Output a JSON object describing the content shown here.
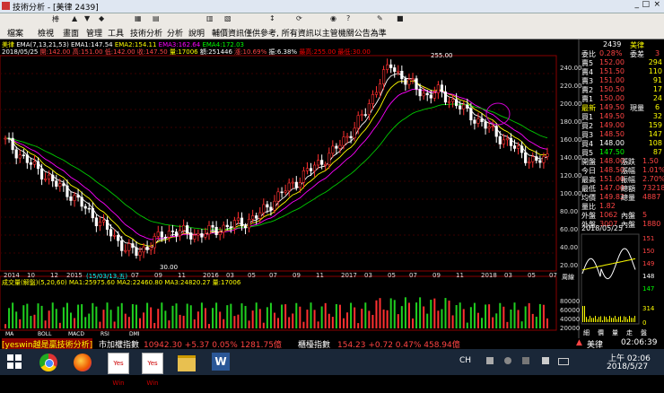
{
  "window": {
    "title": "技術分析 - [美律 2439]",
    "min": "_",
    "max": "□",
    "close": "×"
  },
  "toolbar": {
    "chart_btn": "棒",
    "items": [
      "▲",
      "▼",
      "◆",
      "▦",
      "▤",
      "▥",
      "▧",
      "↕",
      "⟳",
      "◉",
      "?",
      "✎",
      "■"
    ]
  },
  "menu": [
    "檔案",
    "檢視",
    "畫面",
    "管理",
    "工具",
    "技術分析",
    "分析",
    "說明",
    "輔價資訊僅供參考, 所有資訊以主管機關公告為準"
  ],
  "indicator_line": {
    "name": "美律",
    "ema": "EMA(7,13,21,53)",
    "ema1": "EMA1:147.54",
    "ema2": "EMA2:154.11",
    "ema3": "EMA3:162.64",
    "ema4": "EMA4:172.03",
    "date": "2018/05/25",
    "o": "開:142.00",
    "h": "高:151.00",
    "l": "低:142.00",
    "c": "收:147.50",
    "v": "量:17006",
    "amt": "額:251446",
    "chg": "漲:10.69%",
    "chgv": "振:6.38%",
    "extra1": "最高:255.00",
    "extra2": "最低:30.00"
  },
  "price_axis": [
    "240.00",
    "220.00",
    "200.00",
    "180.00",
    "160.00",
    "140.00",
    "120.00",
    "100.00",
    "80.00",
    "60.00",
    "40.00",
    "20.00"
  ],
  "annotations": {
    "high": "255.00",
    "low": "30.00"
  },
  "time_axis": [
    "2014",
    "10",
    "12",
    "2015",
    "(15/03/13,五)",
    "07",
    "09",
    "11",
    "2016",
    "03",
    "05",
    "07",
    "09",
    "11",
    "2017",
    "03",
    "05",
    "07",
    "09",
    "11",
    "2018",
    "03",
    "05",
    "07"
  ],
  "volume_header": "成交量(解盤)(5,20,60)  MA1:25975.60  MA2:22460.80  MA3:24820.27  量:17006",
  "volume_axis": [
    "80000",
    "60000",
    "40000",
    "20000"
  ],
  "bottom_tabs": [
    "MA",
    "BOLL",
    "MACD",
    "RSI",
    "DMI"
  ],
  "right_tab": "周線",
  "quote_panel": {
    "code": "2439",
    "name": "美律",
    "header_left": "委比",
    "header_pct": "0.28%",
    "header_right": "委差",
    "header_val": "3",
    "asks": [
      {
        "label": "賣5",
        "price": "152.00",
        "vol": "294"
      },
      {
        "label": "賣4",
        "price": "151.50",
        "vol": "110"
      },
      {
        "label": "賣3",
        "price": "151.00",
        "vol": "91"
      },
      {
        "label": "賣2",
        "price": "150.50",
        "vol": "17"
      },
      {
        "label": "賣1",
        "price": "150.00",
        "vol": "24"
      }
    ],
    "last": {
      "label": "最新",
      "price": "149.50",
      "vol_label": "現量",
      "vol": "6"
    },
    "bids": [
      {
        "label": "買1",
        "price": "149.50",
        "vol": "32"
      },
      {
        "label": "買2",
        "price": "149.00",
        "vol": "159"
      },
      {
        "label": "買3",
        "price": "148.50",
        "vol": "147"
      },
      {
        "label": "買4",
        "price": "148.00",
        "vol": "108"
      },
      {
        "label": "買5",
        "price": "147.50",
        "vol": "87"
      }
    ],
    "stats": [
      {
        "l": "開盤",
        "lv": "148.00",
        "r": "漲跌",
        "rv": "1.50"
      },
      {
        "l": "今日",
        "lv": "148.50",
        "r": "漲幅",
        "rv": "1.01%"
      },
      {
        "l": "最高",
        "lv": "151.00",
        "r": "振幅",
        "rv": "2.70%"
      },
      {
        "l": "最低",
        "lv": "147.00",
        "r": "總額",
        "rv": "73218"
      },
      {
        "l": "均價",
        "lv": "149.82",
        "r": "總量",
        "rv": "4887"
      },
      {
        "l": "量比",
        "lv": "1.82",
        "r": "",
        "rv": ""
      },
      {
        "l": "外盤",
        "lv": "1062",
        "r": "內盤",
        "rv": "5"
      },
      {
        "l": "外盤",
        "lv": "3007",
        "r": "內盤",
        "rv": "1880"
      }
    ],
    "date": "2018/05/25",
    "mini_axis": [
      "151",
      "150",
      "149",
      "148",
      "147"
    ],
    "mini_vol_axis": [
      "314",
      "0"
    ],
    "bottom_tabs": [
      "細",
      "價",
      "量",
      "走",
      "盤"
    ]
  },
  "ticker": {
    "brand": "[yeswin越是贏技術分析]",
    "idx1_name": "市加權指數",
    "idx1_val": "10942.30 +5.37 0.05% 1281.75億",
    "idx2_name": "櫃檯指數",
    "idx2_val": "154.23 +0.72 0.47% 458.94億",
    "right_name": "美律",
    "right_arrow": "▲",
    "time": "02:06:39"
  },
  "taskbar": {
    "lang": "CH",
    "time": "上午 02:06",
    "date": "2018/5/27",
    "apps": [
      "Yes Win",
      "Yes Win",
      "Word"
    ]
  },
  "chart_data": {
    "type": "candlestick",
    "title": "美律 2439",
    "y_range": [
      20,
      260
    ],
    "extremes": {
      "high": 255.0,
      "low": 30.0
    },
    "close_series_approx": [
      165,
      152,
      140,
      130,
      118,
      110,
      98,
      85,
      72,
      58,
      45,
      40,
      50,
      60,
      65,
      62,
      60,
      64,
      68,
      72,
      75,
      82,
      95,
      108,
      118,
      130,
      140,
      150,
      165,
      180,
      200,
      230,
      250,
      235,
      225,
      215,
      220,
      210,
      200,
      190,
      180,
      170,
      160,
      150,
      140,
      147.5
    ],
    "ema_labels": [
      "EMA1:147.54",
      "EMA2:154.11",
      "EMA3:162.64",
      "EMA4:172.03"
    ],
    "volume_range": [
      0,
      80000
    ]
  }
}
